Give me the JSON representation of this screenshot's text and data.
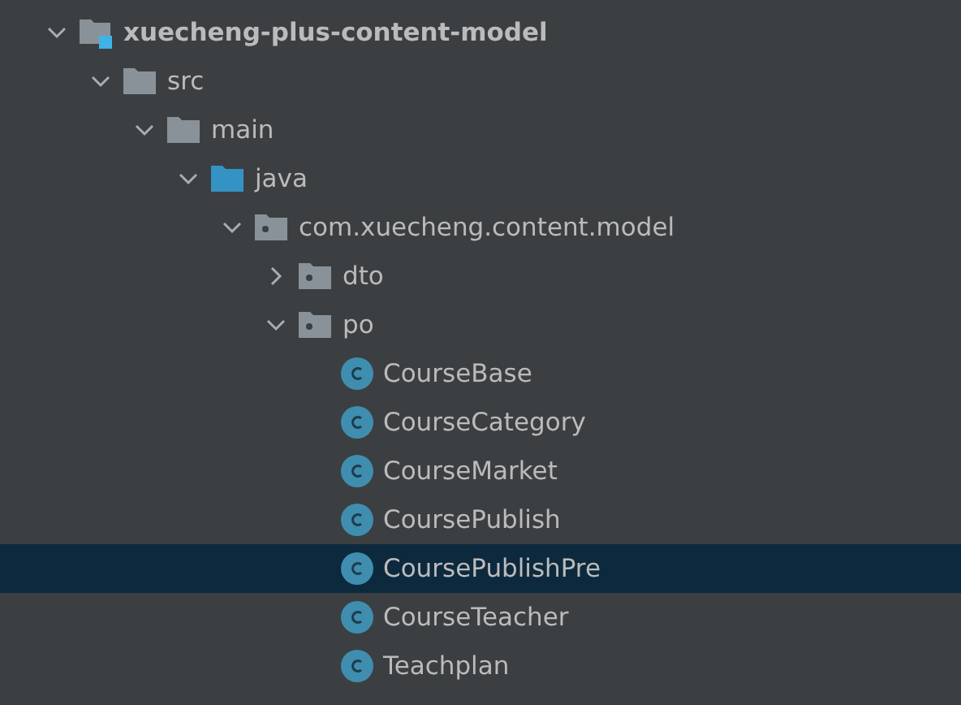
{
  "tree": [
    {
      "kind": "module",
      "label": "xuecheng-plus-content-model",
      "expanded": true,
      "selected": false,
      "children": [
        {
          "kind": "folder",
          "label": "src",
          "expanded": true,
          "selected": false,
          "children": [
            {
              "kind": "folder",
              "label": "main",
              "expanded": true,
              "selected": false,
              "children": [
                {
                  "kind": "source-folder",
                  "label": "java",
                  "expanded": true,
                  "selected": false,
                  "children": [
                    {
                      "kind": "package",
                      "label": "com.xuecheng.content.model",
                      "expanded": true,
                      "selected": false,
                      "children": [
                        {
                          "kind": "package",
                          "label": "dto",
                          "expanded": false,
                          "selected": false
                        },
                        {
                          "kind": "package",
                          "label": "po",
                          "expanded": true,
                          "selected": false,
                          "children": [
                            {
                              "kind": "class",
                              "label": "CourseBase",
                              "selected": false
                            },
                            {
                              "kind": "class",
                              "label": "CourseCategory",
                              "selected": false
                            },
                            {
                              "kind": "class",
                              "label": "CourseMarket",
                              "selected": false
                            },
                            {
                              "kind": "class",
                              "label": "CoursePublish",
                              "selected": false
                            },
                            {
                              "kind": "class",
                              "label": "CoursePublishPre",
                              "selected": true
                            },
                            {
                              "kind": "class",
                              "label": "CourseTeacher",
                              "selected": false
                            },
                            {
                              "kind": "class",
                              "label": "Teachplan",
                              "selected": false
                            }
                          ]
                        }
                      ]
                    }
                  ]
                }
              ]
            }
          ]
        }
      ]
    }
  ]
}
